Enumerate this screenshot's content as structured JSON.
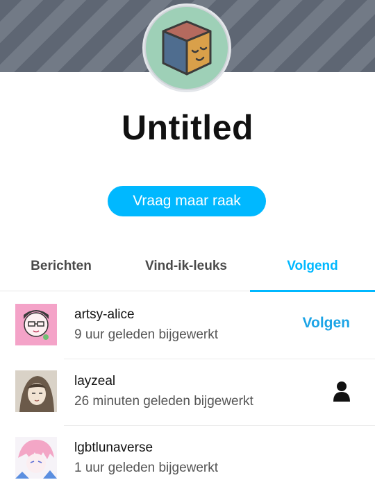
{
  "blog": {
    "title": "Untitled",
    "ask_label": "Vraag maar raak",
    "avatar_icon": "sleepy-cube-icon"
  },
  "tabs": [
    {
      "label": "Berichten",
      "active": false
    },
    {
      "label": "Vind-ik-leuks",
      "active": false
    },
    {
      "label": "Volgend",
      "active": true
    }
  ],
  "following": [
    {
      "name": "artsy-alice",
      "updated": "9 uur geleden bijgewerkt",
      "action": "Volgen"
    },
    {
      "name": "layzeal",
      "updated": "26 minuten geleden bijgewerkt",
      "action_icon": "person-icon"
    },
    {
      "name": "lgbtlunaverse",
      "updated": "1 uur geleden bijgewerkt"
    }
  ],
  "colors": {
    "accent": "#00b8ff",
    "follow_text": "#1ca4e6",
    "avatar_bg": "#9ed0b7",
    "banner_stripe_dark": "#5e6673",
    "banner_stripe_light": "#727a86"
  }
}
